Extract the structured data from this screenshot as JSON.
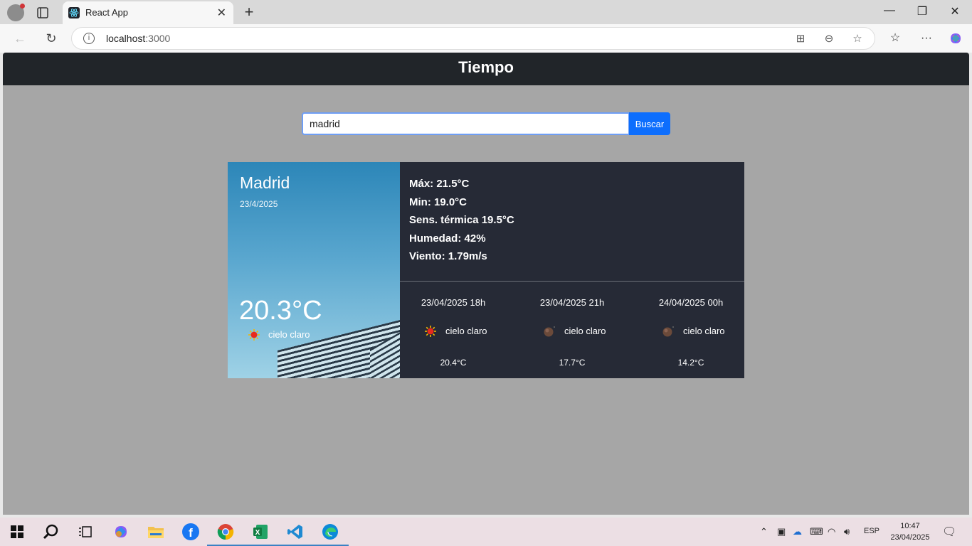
{
  "browser": {
    "tab_title": "React App",
    "url_host": "localhost",
    "url_port": ":3000"
  },
  "app": {
    "title": "Tiempo",
    "search": {
      "value": "madrid",
      "button_label": "Buscar"
    },
    "current": {
      "city": "Madrid",
      "date": "23/4/2025",
      "temperature": "20.3°C",
      "description": "cielo claro",
      "icon": "sun-icon"
    },
    "details": {
      "max": "Máx: 21.5°C",
      "min": "Min: 19.0°C",
      "feels_like": "Sens. térmica 19.5°C",
      "humidity": "Humedad: 42%",
      "wind": "Viento: 1.79m/s"
    },
    "forecast": [
      {
        "time": "23/04/2025 18h",
        "description": "cielo claro",
        "temp": "20.4°C",
        "icon": "sun-icon"
      },
      {
        "time": "23/04/2025 21h",
        "description": "cielo claro",
        "temp": "17.7°C",
        "icon": "moon-icon"
      },
      {
        "time": "24/04/2025 00h",
        "description": "cielo claro",
        "temp": "14.2°C",
        "icon": "moon-icon"
      }
    ]
  },
  "taskbar": {
    "language": "ESP",
    "time": "10:47",
    "date": "23/04/2025"
  }
}
